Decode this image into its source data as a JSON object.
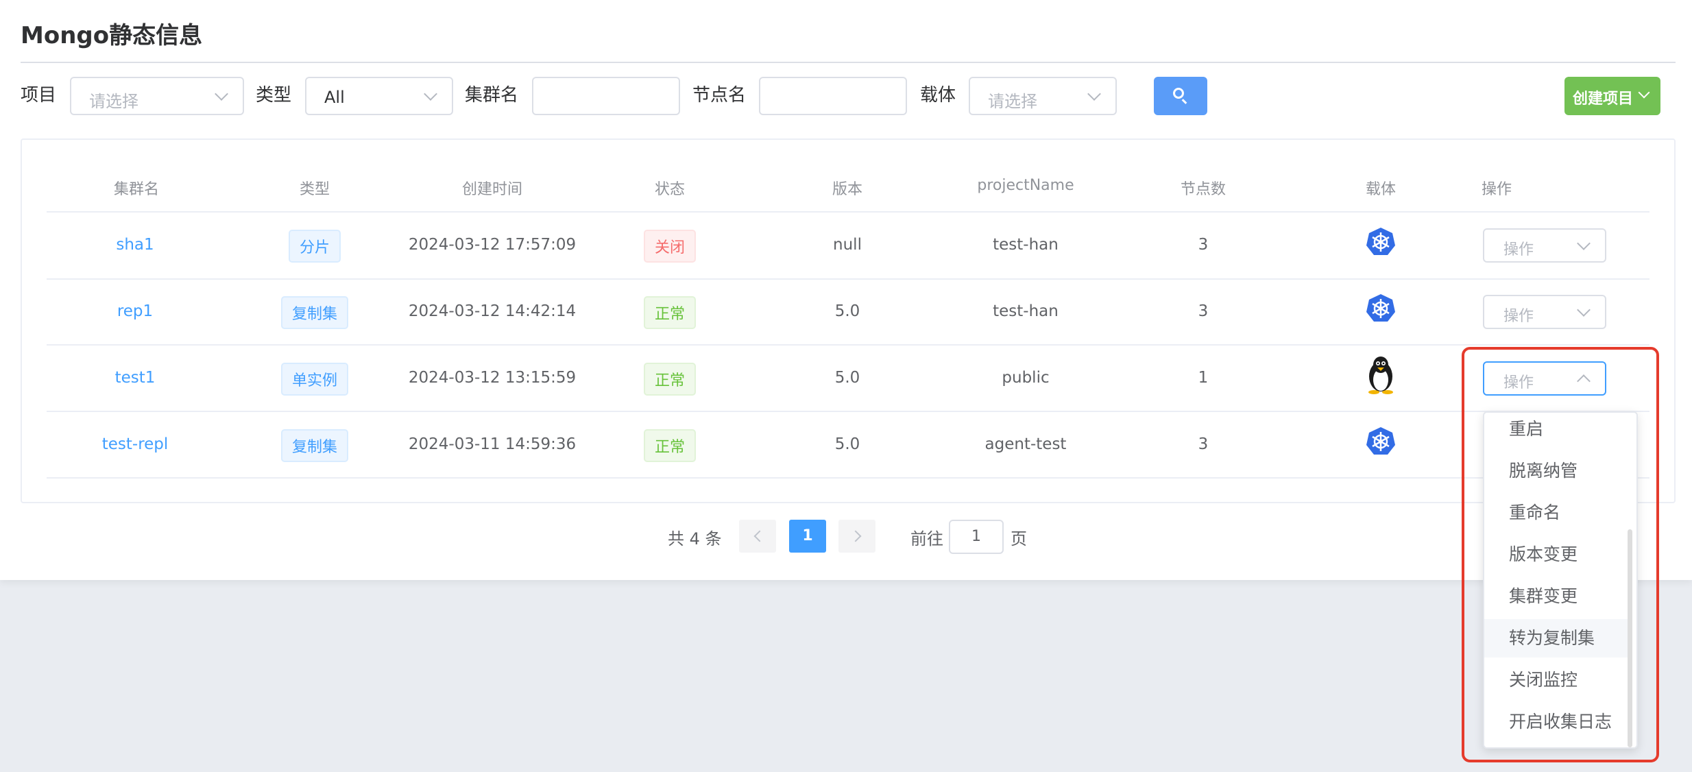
{
  "page": {
    "title": "Mongo静态信息"
  },
  "filters": {
    "project_label": "项目",
    "project_placeholder": "请选择",
    "type_label": "类型",
    "type_value": "All",
    "cluster_label": "集群名",
    "cluster_value": "",
    "node_label": "节点名",
    "node_value": "",
    "carrier_label": "载体",
    "carrier_placeholder": "请选择",
    "search_icon": "search-icon",
    "create_label": "创建项目"
  },
  "table": {
    "headers": [
      "集群名",
      "类型",
      "创建时间",
      "状态",
      "版本",
      "projectName",
      "节点数",
      "载体",
      "操作"
    ],
    "rows": [
      {
        "name": "sha1",
        "type": "分片",
        "created": "2024-03-12 17:57:09",
        "status": "关闭",
        "status_color": "red",
        "version": "null",
        "project": "test-han",
        "nodes": "3",
        "carrier_icon": "kubernetes-icon",
        "op": "操作"
      },
      {
        "name": "rep1",
        "type": "复制集",
        "created": "2024-03-12 14:42:14",
        "status": "正常",
        "status_color": "green",
        "version": "5.0",
        "project": "test-han",
        "nodes": "3",
        "carrier_icon": "kubernetes-icon",
        "op": "操作"
      },
      {
        "name": "test1",
        "type": "单实例",
        "created": "2024-03-12 13:15:59",
        "status": "正常",
        "status_color": "green",
        "version": "5.0",
        "project": "public",
        "nodes": "1",
        "carrier_icon": "linux-penguin-icon",
        "op": "操作"
      },
      {
        "name": "test-repl",
        "type": "复制集",
        "created": "2024-03-11 14:59:36",
        "status": "正常",
        "status_color": "green",
        "version": "5.0",
        "project": "agent-test",
        "nodes": "3",
        "carrier_icon": "kubernetes-icon",
        "op": ""
      }
    ]
  },
  "pagination": {
    "total_text": "共 4 条",
    "current_page": "1",
    "goto_label": "前往",
    "goto_value": "1",
    "page_suffix": "页"
  },
  "menu": {
    "items": [
      "重启",
      "脱离纳管",
      "重命名",
      "版本变更",
      "集群变更",
      "转为复制集",
      "关闭监控",
      "开启收集日志"
    ],
    "hovered": "转为复制集"
  },
  "colors": {
    "primary": "#409eff",
    "success": "#67c23a",
    "danger": "#f56c6c",
    "create": "#73c154",
    "highlight": "#e53b2c"
  }
}
